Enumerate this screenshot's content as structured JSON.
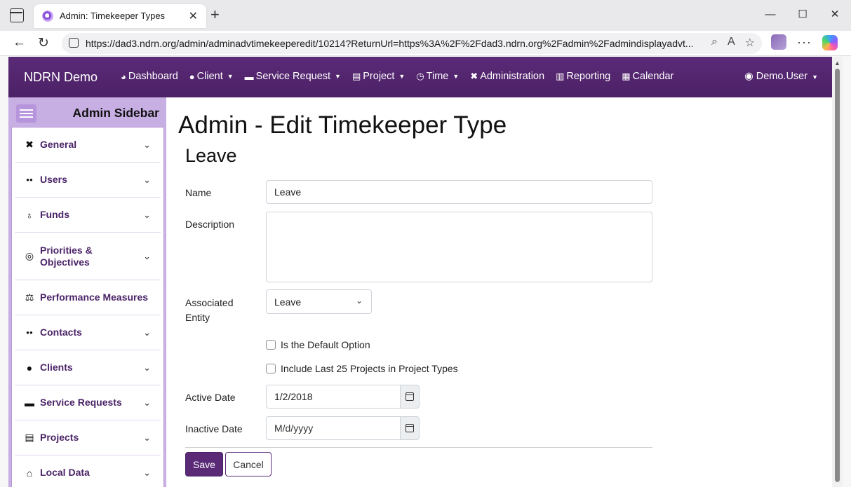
{
  "browser": {
    "tab_title": "Admin: Timekeeper Types",
    "url": "https://dad3.ndrn.org/admin/adminadvtimekeeperedit/10214?ReturnUrl=https%3A%2F%2Fdad3.ndrn.org%2Fadmin%2Fadmindisplayadvt..."
  },
  "topnav": {
    "brand": "NDRN Demo",
    "items": [
      {
        "label": "Dashboard",
        "icon": "dashboard-icon",
        "dropdown": false
      },
      {
        "label": "Client",
        "icon": "user-icon",
        "dropdown": true
      },
      {
        "label": "Service Request",
        "icon": "briefcase-icon",
        "dropdown": true
      },
      {
        "label": "Project",
        "icon": "clipboard-icon",
        "dropdown": true
      },
      {
        "label": "Time",
        "icon": "clock-icon",
        "dropdown": true
      },
      {
        "label": "Administration",
        "icon": "tools-icon",
        "dropdown": false
      },
      {
        "label": "Reporting",
        "icon": "document-icon",
        "dropdown": false
      },
      {
        "label": "Calendar",
        "icon": "calendar-icon",
        "dropdown": false
      }
    ],
    "user": "Demo.User"
  },
  "sidebar": {
    "title": "Admin Sidebar",
    "items": [
      {
        "label": "General",
        "icon": "tools-icon",
        "expandable": true
      },
      {
        "label": "Users",
        "icon": "users-icon",
        "expandable": true
      },
      {
        "label": "Funds",
        "icon": "money-bag-icon",
        "expandable": true
      },
      {
        "label": "Priorities & Objectives",
        "icon": "target-icon",
        "expandable": true
      },
      {
        "label": "Performance Measures",
        "icon": "scale-icon",
        "expandable": false
      },
      {
        "label": "Contacts",
        "icon": "contacts-icon",
        "expandable": true
      },
      {
        "label": "Clients",
        "icon": "user-icon",
        "expandable": true
      },
      {
        "label": "Service Requests",
        "icon": "briefcase-icon",
        "expandable": true
      },
      {
        "label": "Projects",
        "icon": "clipboard-icon",
        "expandable": true
      },
      {
        "label": "Local Data",
        "icon": "house-icon",
        "expandable": true
      }
    ]
  },
  "main": {
    "page_title": "Admin - Edit Timekeeper Type",
    "subtitle": "Leave",
    "form": {
      "name_label": "Name",
      "name_value": "Leave",
      "description_label": "Description",
      "description_value": "",
      "entity_label": "Associated Entity",
      "entity_value": "Leave",
      "default_option_label": "Is the Default Option",
      "include_projects_label": "Include Last 25 Projects in Project Types",
      "active_date_label": "Active Date",
      "active_date_value": "1/2/2018",
      "inactive_date_label": "Inactive Date",
      "inactive_date_placeholder": "M/d/yyyy",
      "save_label": "Save",
      "cancel_label": "Cancel"
    }
  },
  "colors": {
    "brand_purple": "#5a2a77",
    "sidebar_lavender": "#c7aee3"
  }
}
